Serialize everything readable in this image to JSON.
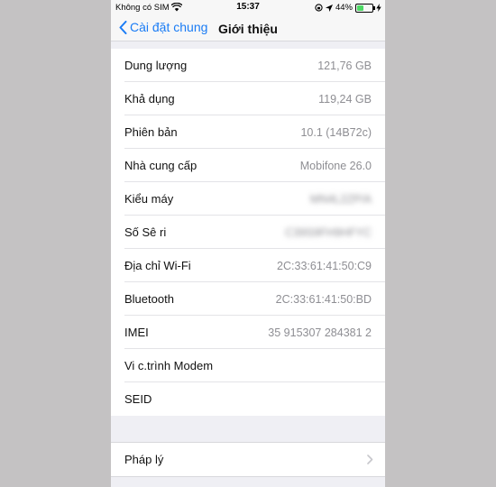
{
  "status": {
    "carrier": "Không có SIM",
    "time": "15:37",
    "battery": "44%",
    "battery_level": 0.44
  },
  "nav": {
    "back_label": "Cài đặt chung",
    "title": "Giới thiệu"
  },
  "rows": [
    {
      "label": "Dung lượng",
      "value": "121,76 GB"
    },
    {
      "label": "Khả dụng",
      "value": "119,24 GB"
    },
    {
      "label": "Phiên bản",
      "value": "10.1 (14B72c)"
    },
    {
      "label": "Nhà cung cấp",
      "value": "Mobifone 26.0"
    },
    {
      "label": "Kiểu máy",
      "value": "MN4L2ZP/A"
    },
    {
      "label": "Số Sê ri",
      "value": "C39S9FH9HFYC"
    },
    {
      "label": "Địa chỉ Wi-Fi",
      "value": "2C:33:61:41:50:C9"
    },
    {
      "label": "Bluetooth",
      "value": "2C:33:61:41:50:BD"
    },
    {
      "label": "IMEI",
      "value": "35 915307 284381 2"
    },
    {
      "label": "Vi c.trình Modem",
      "value": ""
    },
    {
      "label": "SEID",
      "value": ""
    }
  ],
  "legal": {
    "label": "Pháp lý"
  }
}
